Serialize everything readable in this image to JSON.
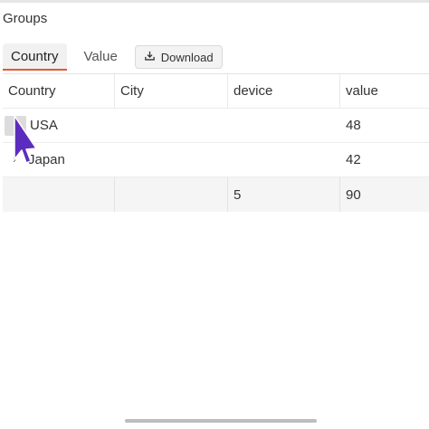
{
  "panel": {
    "title": "Groups"
  },
  "tabs": [
    {
      "label": "Country",
      "active": true
    },
    {
      "label": "Value",
      "active": false
    }
  ],
  "download": {
    "label": "Download",
    "icon": "download-icon"
  },
  "table": {
    "columns": [
      "Country",
      "City",
      "device",
      "value"
    ],
    "rows": [
      {
        "country": "USA",
        "city": "",
        "device": "",
        "value": "48"
      },
      {
        "country": "Japan",
        "city": "",
        "device": "",
        "value": "42"
      }
    ],
    "footer": {
      "country": "",
      "city": "",
      "device": "5",
      "value": "90"
    }
  },
  "colors": {
    "accent": "#e4572e",
    "cursor": "#5b2dbe"
  }
}
